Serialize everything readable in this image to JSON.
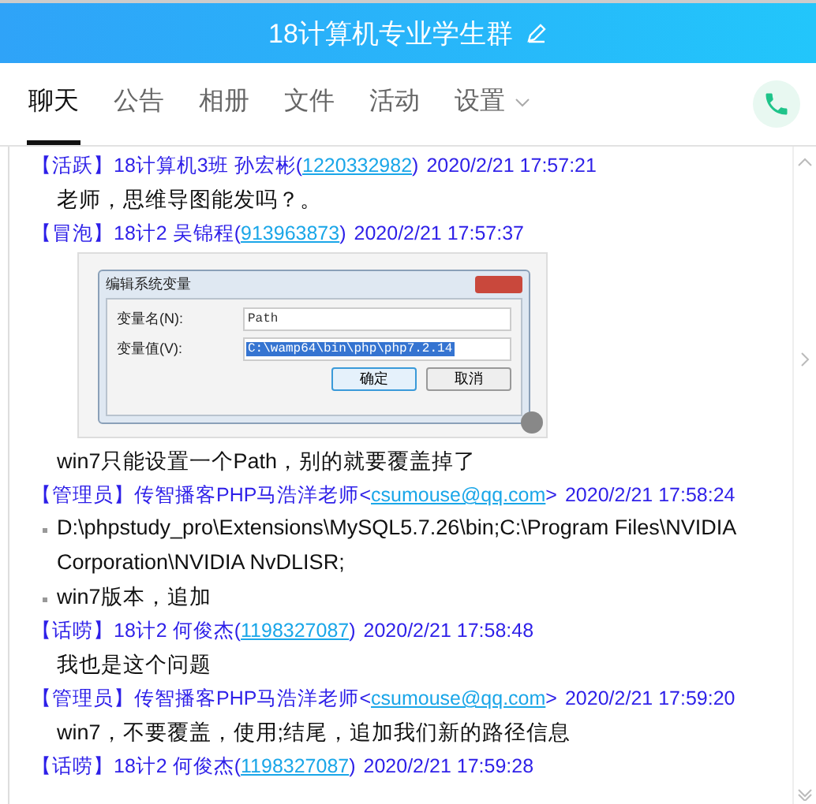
{
  "window": {
    "title": "18计算机专业学生群"
  },
  "tabs": [
    {
      "label": "聊天",
      "selected": true,
      "dropdown": false
    },
    {
      "label": "公告",
      "selected": false,
      "dropdown": false
    },
    {
      "label": "相册",
      "selected": false,
      "dropdown": false
    },
    {
      "label": "文件",
      "selected": false,
      "dropdown": false
    },
    {
      "label": "活动",
      "selected": false,
      "dropdown": false
    },
    {
      "label": "设置",
      "selected": false,
      "dropdown": true
    }
  ],
  "messages": [
    {
      "badge": "【活跃】",
      "name": "18计算机3班 孙宏彬",
      "open": "(",
      "contact": "1220332982",
      "close": ")",
      "time": "2020/2/21 17:57:21",
      "content": [
        {
          "kind": "text",
          "text": "老师，思维导图能发吗？。"
        }
      ]
    },
    {
      "badge": "【冒泡】",
      "name": "18计2 吴锦程",
      "open": "(",
      "contact": "913963873",
      "close": ")",
      "time": "2020/2/21 17:57:37",
      "content": [
        {
          "kind": "image",
          "dialog": {
            "title": "编辑系统变量",
            "fields": [
              {
                "label": "变量名(N):",
                "value": "Path",
                "selected": false
              },
              {
                "label": "变量值(V):",
                "value": "C:\\wamp64\\bin\\php\\php7.2.14",
                "selected": true
              }
            ],
            "buttons": [
              "确定",
              "取消"
            ]
          }
        },
        {
          "kind": "text",
          "text": "win7只能设置一个Path，别的就要覆盖掉了"
        }
      ]
    },
    {
      "badge": "【管理员】",
      "name": "传智播客PHP马浩洋老师",
      "open": "<",
      "contact": "csumouse@qq.com",
      "close": ">",
      "time": "2020/2/21 17:58:24",
      "content": [
        {
          "kind": "bullet",
          "text": "D:\\phpstudy_pro\\Extensions\\MySQL5.7.26\\bin;C:\\Program Files\\NVIDIA Corporation\\NVIDIA NvDLISR;"
        },
        {
          "kind": "bullet",
          "text": "win7版本，追加"
        }
      ]
    },
    {
      "badge": "【话唠】",
      "name": "18计2 何俊杰",
      "open": "(",
      "contact": "1198327087",
      "close": ")",
      "time": "2020/2/21 17:58:48",
      "content": [
        {
          "kind": "text",
          "text": "我也是这个问题"
        }
      ]
    },
    {
      "badge": "【管理员】",
      "name": "传智播客PHP马浩洋老师",
      "open": "<",
      "contact": "csumouse@qq.com",
      "close": ">",
      "time": "2020/2/21 17:59:20",
      "content": [
        {
          "kind": "text",
          "text": "win7，不要覆盖，使用;结尾，追加我们新的路径信息"
        }
      ]
    },
    {
      "badge": "【话唠】",
      "name": "18计2 何俊杰",
      "open": "(",
      "contact": "1198327087",
      "close": ")",
      "time": "2020/2/21 17:59:28"
    }
  ]
}
